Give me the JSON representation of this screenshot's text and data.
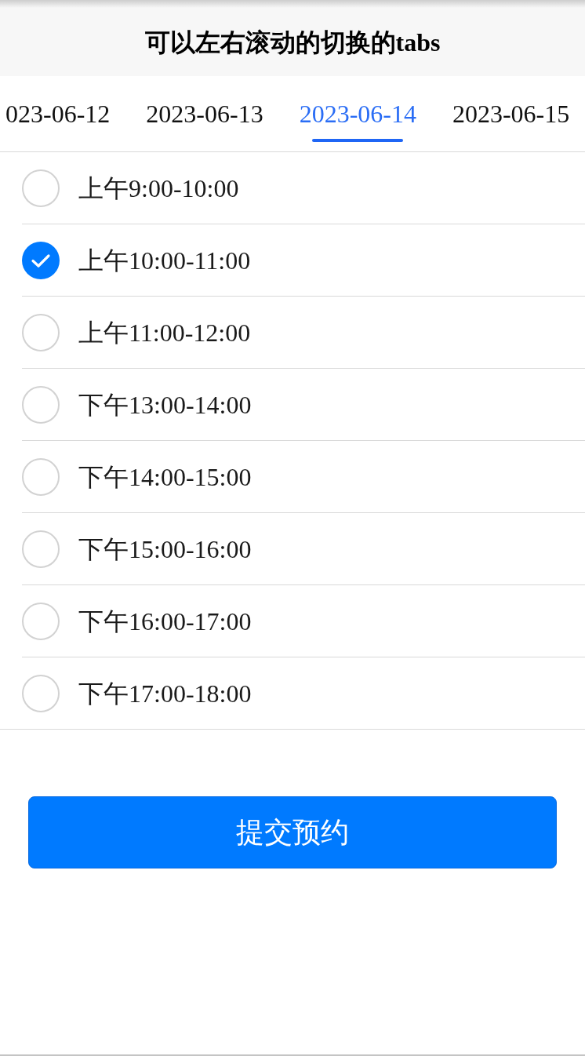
{
  "header": {
    "title": "可以左右滚动的切换的tabs"
  },
  "tabs": [
    {
      "label": "023-06-12",
      "selected": false
    },
    {
      "label": "2023-06-13",
      "selected": false
    },
    {
      "label": "2023-06-14",
      "selected": true
    },
    {
      "label": "2023-06-15",
      "selected": false
    }
  ],
  "slots": [
    {
      "label": "上午9:00-10:00",
      "selected": false
    },
    {
      "label": "上午10:00-11:00",
      "selected": true
    },
    {
      "label": "上午11:00-12:00",
      "selected": false
    },
    {
      "label": "下午13:00-14:00",
      "selected": false
    },
    {
      "label": "下午14:00-15:00",
      "selected": false
    },
    {
      "label": "下午15:00-16:00",
      "selected": false
    },
    {
      "label": "下午16:00-17:00",
      "selected": false
    },
    {
      "label": "下午17:00-18:00",
      "selected": false
    }
  ],
  "submit_button": {
    "label": "提交预约"
  }
}
